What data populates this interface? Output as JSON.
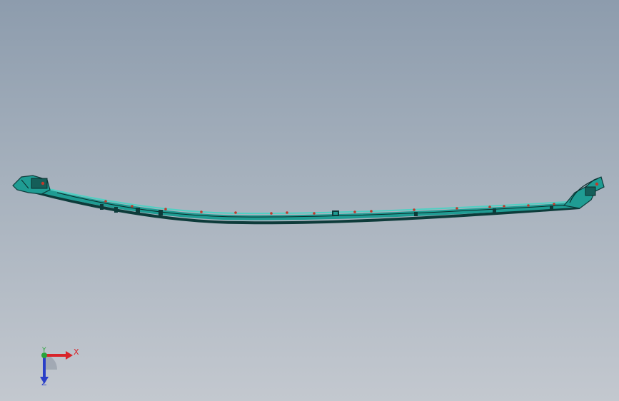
{
  "viewport": {
    "background_top": "#8d9cad",
    "background_bottom": "#c3c8cf"
  },
  "model": {
    "part_color": "#1f9c93",
    "part_edge_color": "#0d3b3a",
    "fastener_color": "#c0392b"
  },
  "triad": {
    "x_label": "X",
    "y_label": "Y",
    "z_label": "Z",
    "x_color": "#d8242a",
    "y_color": "#2aa33a",
    "z_color": "#2a3fc8"
  }
}
